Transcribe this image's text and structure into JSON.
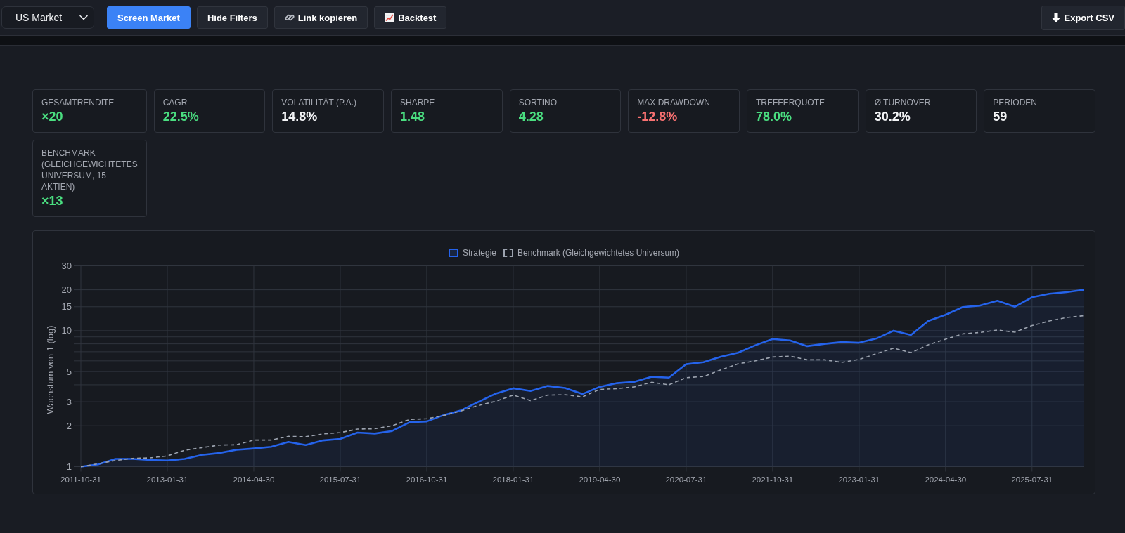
{
  "toolbar": {
    "market_select": {
      "value": "US Market"
    },
    "buttons": [
      {
        "label": "Screen Market",
        "kind": "primary"
      },
      {
        "label": "Hide Filters",
        "kind": "plain"
      },
      {
        "label": "Link kopieren",
        "kind": "share"
      },
      {
        "label": "Backtest",
        "kind": "backtest"
      }
    ],
    "export_button": {
      "label": "Export CSV"
    }
  },
  "metrics": [
    {
      "label": "GESAMTRENDITE",
      "value": "×20",
      "color": "#4ade80"
    },
    {
      "label": "CAGR",
      "value": "22.5%",
      "color": "#4ade80"
    },
    {
      "label": "VOLATILITÄT (P.A.)",
      "value": "14.8%",
      "color": "#f3f4f6"
    },
    {
      "label": "SHARPE",
      "value": "1.48",
      "color": "#4ade80"
    },
    {
      "label": "SORTINO",
      "value": "4.28",
      "color": "#4ade80"
    },
    {
      "label": "MAX DRAWDOWN",
      "value": "-12.8%",
      "color": "#f87171"
    },
    {
      "label": "TREFFERQUOTE",
      "value": "78.0%",
      "color": "#4ade80"
    },
    {
      "label": "Ø TURNOVER",
      "value": "30.2%",
      "color": "#f3f4f6"
    },
    {
      "label": "PERIODEN",
      "value": "59",
      "color": "#f3f4f6"
    },
    {
      "label": "BENCHMARK (GLEICHGEWICHTETES UNIVERSUM, 15 AKTIEN)",
      "value": "×13",
      "color": "#4ade80"
    }
  ],
  "chart": {
    "chart_data": {
      "type": "line",
      "ylabel": "Wachstum von 1 (log)",
      "log": true,
      "grid": true,
      "legend": "top",
      "categories": [
        "2011-10-31",
        null,
        null,
        null,
        null,
        "2013-01-31",
        null,
        null,
        null,
        null,
        "2014-04-30",
        null,
        null,
        null,
        null,
        "2015-07-31",
        null,
        null,
        null,
        null,
        "2016-10-31",
        null,
        null,
        null,
        null,
        "2018-01-31",
        null,
        null,
        null,
        null,
        "2019-04-30",
        null,
        null,
        null,
        null,
        "2020-07-31",
        null,
        null,
        null,
        null,
        "2021-10-31",
        null,
        null,
        null,
        null,
        "2023-01-31",
        null,
        null,
        null,
        null,
        "2024-04-30",
        null,
        null,
        null,
        null,
        "2025-07-31",
        null,
        null,
        null
      ],
      "ylim": [
        1,
        30
      ],
      "yticks": [
        1,
        2,
        3,
        5,
        10,
        15,
        20,
        30
      ],
      "series": [
        {
          "name": "Strategie",
          "color": "#2563eb",
          "line_style": "solid",
          "values": [
            1.0,
            1.04,
            1.14,
            1.14,
            1.12,
            1.11,
            1.14,
            1.22,
            1.26,
            1.33,
            1.36,
            1.4,
            1.52,
            1.44,
            1.56,
            1.6,
            1.78,
            1.75,
            1.83,
            2.12,
            2.15,
            2.4,
            2.6,
            3.0,
            3.45,
            3.77,
            3.6,
            3.92,
            3.79,
            3.42,
            3.86,
            4.11,
            4.2,
            4.58,
            4.51,
            5.67,
            5.87,
            6.43,
            6.88,
            7.82,
            8.68,
            8.48,
            7.7,
            8.0,
            8.25,
            8.15,
            8.75,
            10.0,
            9.3,
            11.8,
            13.1,
            14.9,
            15.3,
            16.6,
            15.0,
            17.6,
            18.7,
            19.2,
            20.0
          ]
        },
        {
          "name": "Benchmark (Gleichgewichtetes Universum)",
          "color": "#9ca3af",
          "line_style": "dashed",
          "values": [
            1.0,
            1.05,
            1.11,
            1.15,
            1.16,
            1.2,
            1.32,
            1.38,
            1.44,
            1.45,
            1.57,
            1.57,
            1.67,
            1.66,
            1.74,
            1.78,
            1.89,
            1.9,
            2.0,
            2.22,
            2.25,
            2.38,
            2.57,
            2.82,
            3.03,
            3.36,
            3.06,
            3.36,
            3.38,
            3.26,
            3.7,
            3.75,
            3.86,
            4.17,
            4.0,
            4.51,
            4.6,
            5.14,
            5.7,
            6.0,
            6.4,
            6.5,
            6.1,
            6.1,
            5.85,
            6.15,
            6.77,
            7.44,
            6.88,
            7.87,
            8.65,
            9.48,
            9.7,
            10.1,
            9.75,
            10.9,
            11.8,
            12.5,
            12.9
          ]
        }
      ]
    }
  }
}
